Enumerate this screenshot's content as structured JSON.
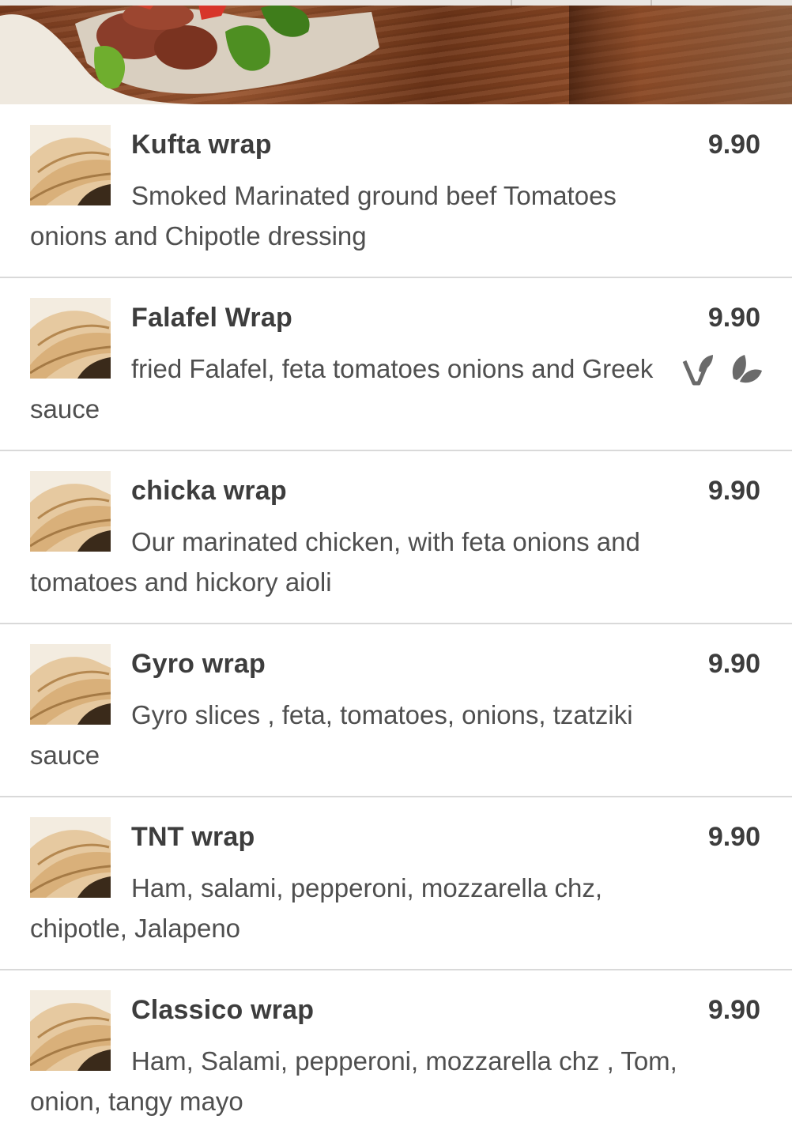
{
  "menu": {
    "items": [
      {
        "name": "Kufta wrap",
        "price": "9.90",
        "description": "Smoked Marinated ground beef Tomatoes onions and Chipotle dressing",
        "badges": []
      },
      {
        "name": "Falafel Wrap",
        "price": "9.90",
        "description": "fried Falafel, feta tomatoes onions and Greek sauce",
        "badges": [
          "vegetarian-v-icon",
          "leaf-icon"
        ]
      },
      {
        "name": "chicka wrap",
        "price": "9.90",
        "description": "Our marinated chicken, with feta onions and tomatoes and hickory aioli",
        "badges": []
      },
      {
        "name": "Gyro wrap",
        "price": "9.90",
        "description": "Gyro slices , feta, tomatoes, onions, tzatziki sauce",
        "badges": []
      },
      {
        "name": "TNT wrap",
        "price": "9.90",
        "description": "Ham, salami, pepperoni, mozzarella chz, chipotle, Jalapeno",
        "badges": []
      },
      {
        "name": "Classico wrap",
        "price": "9.90",
        "description": "Ham, Salami, pepperoni, mozzarella chz , Tom, onion, tangy mayo",
        "badges": []
      }
    ]
  },
  "colors": {
    "text": "#3d3d3d",
    "divider": "#d9d9d9",
    "badge": "#6a6a6a"
  }
}
